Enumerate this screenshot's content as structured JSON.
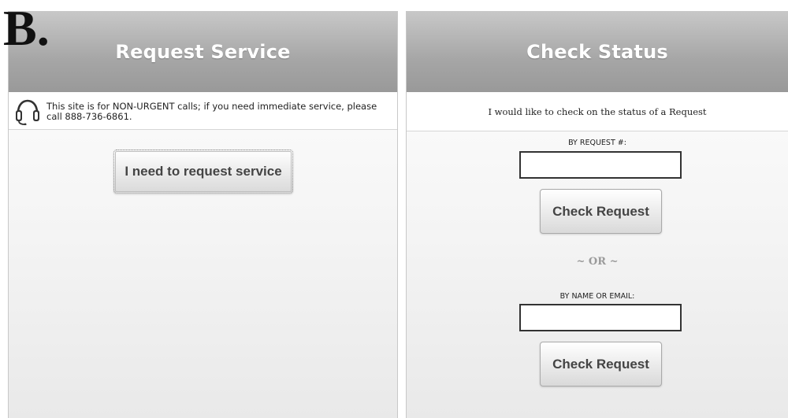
{
  "figure_label": "B.",
  "left_panel": {
    "title": "Request Service",
    "notice_icon": "headset-icon",
    "notice_text": "This site is for NON-URGENT calls; if you need immediate service, please call 888-736-6861.",
    "request_button_label": "I need to request service"
  },
  "right_panel": {
    "title": "Check Status",
    "intro_text": "I would like to check on the status of a Request",
    "by_request_label": "BY REQUEST #:",
    "request_number_value": "",
    "check_request_label_1": "Check Request",
    "or_text": "~ OR ~",
    "by_name_label": "BY NAME OR EMAIL:",
    "name_email_value": "",
    "check_request_label_2": "Check Request"
  }
}
